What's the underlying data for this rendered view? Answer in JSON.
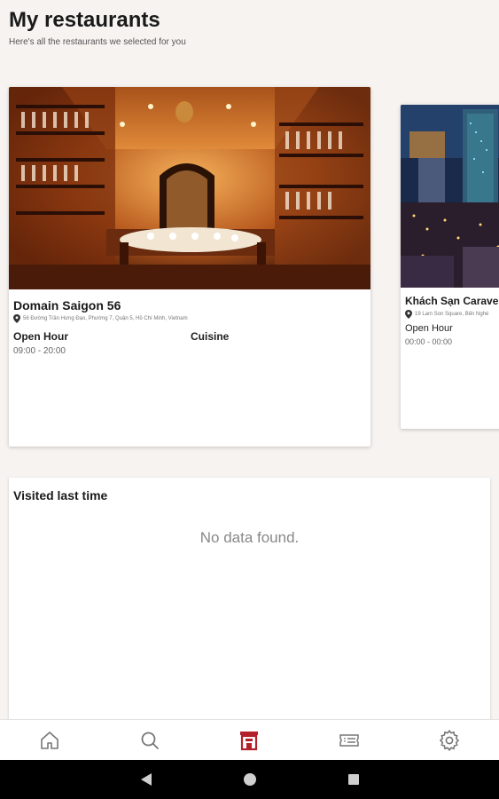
{
  "header": {
    "title": "My restaurants",
    "subtitle": "Here's all the restaurants we selected for you"
  },
  "restaurants": [
    {
      "name": "Domain Saigon 56",
      "address": "56 Đường Trần Hưng Đạo, Phường 7, Quận 5, Hồ Chí Minh, Vietnam",
      "open_hour_label": "Open Hour",
      "open_hour_value": "09:00 - 20:00",
      "cuisine_label": "Cuisine",
      "image": "wine-cellar-dining-room"
    },
    {
      "name": "Khách Sạn Caravelle",
      "address": "19 Lam Son Square, Bến Nghé",
      "open_hour_label": "Open Hour",
      "open_hour_value": "00:00 - 00:00",
      "image": "city-night-skyline"
    }
  ],
  "visited": {
    "title": "Visited last time",
    "empty_text": "No data found."
  },
  "nav": {
    "items": [
      {
        "icon": "home-icon"
      },
      {
        "icon": "search-icon"
      },
      {
        "icon": "restaurant-icon",
        "active": true
      },
      {
        "icon": "ticket-icon"
      },
      {
        "icon": "settings-icon"
      }
    ]
  },
  "colors": {
    "accent": "#b3202a",
    "background": "#f7f3f1",
    "nav_icon": "#777777"
  }
}
